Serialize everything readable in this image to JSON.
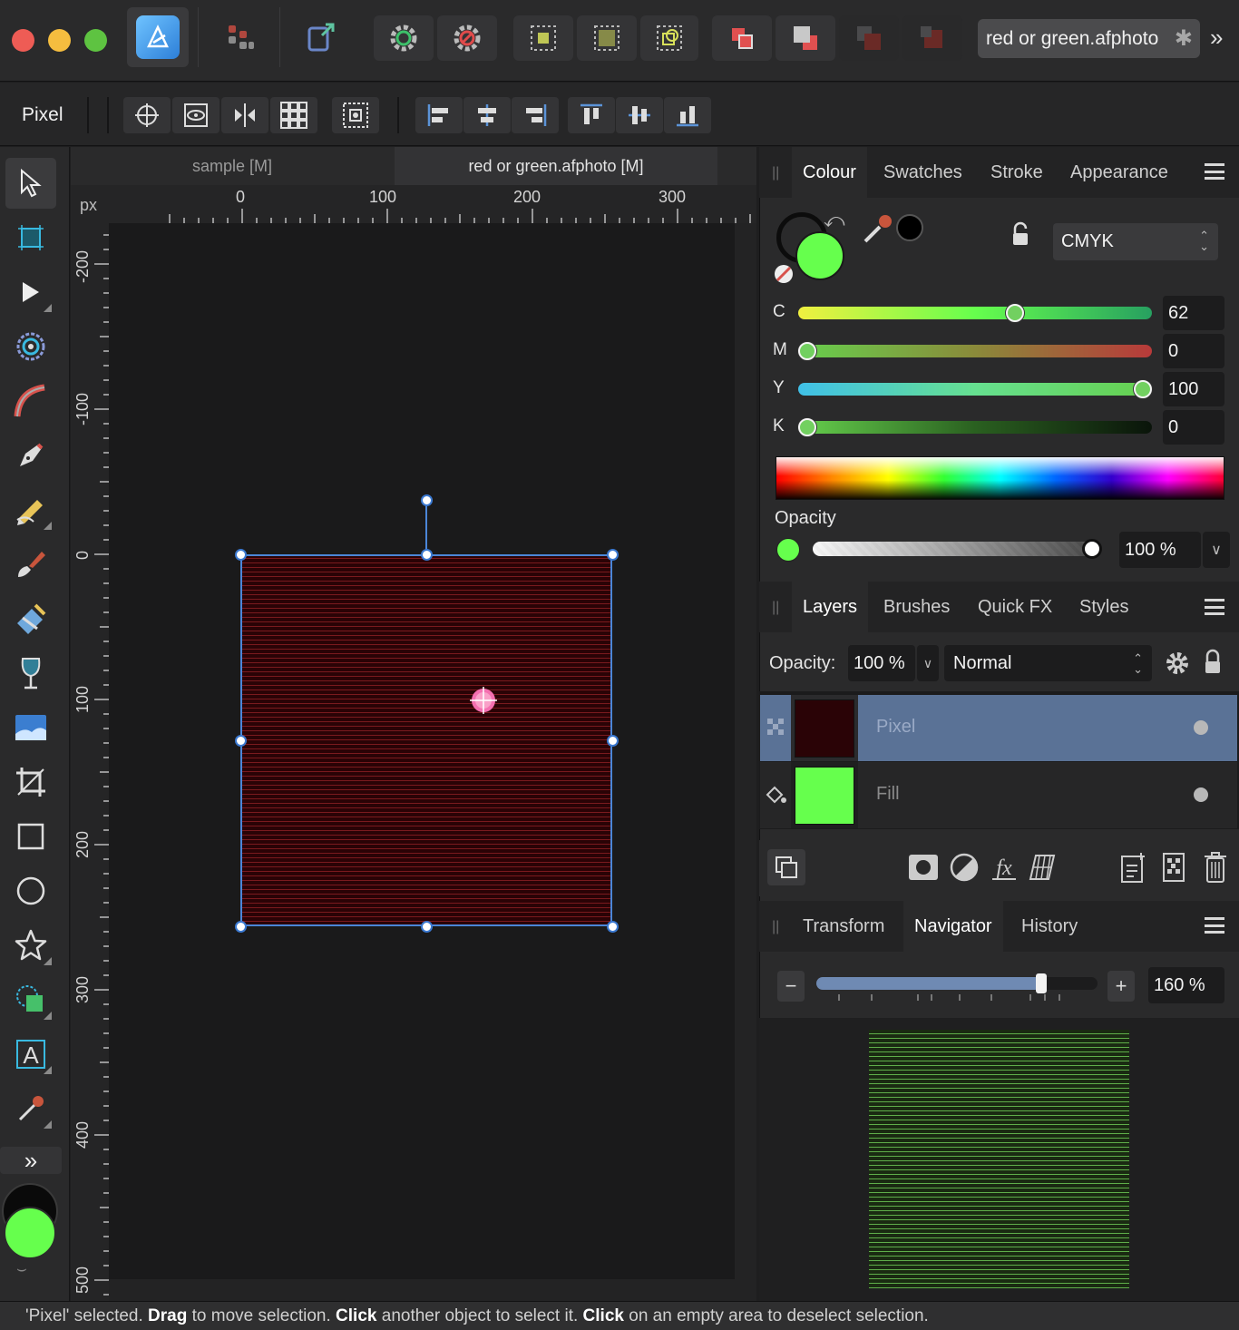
{
  "window": {
    "document_title": "red or green.afphoto"
  },
  "context_toolbar": {
    "label": "Pixel"
  },
  "document_tabs": [
    "sample [M]",
    "red or green.afphoto [M]"
  ],
  "rulers": {
    "unit": "px",
    "top_labels": [
      "0",
      "100",
      "200",
      "300"
    ],
    "left_labels": [
      "-200",
      "-100",
      "0",
      "100",
      "200",
      "300",
      "400",
      "500"
    ]
  },
  "colour_panel": {
    "tabs": [
      "Colour",
      "Swatches",
      "Stroke",
      "Appearance"
    ],
    "active_tab": "Colour",
    "model": "CMYK",
    "fill_color": "#66ff4d",
    "channels": [
      {
        "label": "C",
        "value": "62",
        "fraction": 0.62
      },
      {
        "label": "M",
        "value": "0",
        "fraction": 0.0
      },
      {
        "label": "Y",
        "value": "100",
        "fraction": 1.0
      },
      {
        "label": "K",
        "value": "0",
        "fraction": 0.0
      }
    ],
    "opacity_label": "Opacity",
    "opacity_value": "100 %"
  },
  "layers_panel": {
    "tabs": [
      "Layers",
      "Brushes",
      "Quick FX",
      "Styles"
    ],
    "active_tab": "Layers",
    "opacity_label": "Opacity:",
    "opacity_value": "100 %",
    "blend_mode": "Normal",
    "layers": [
      {
        "name": "Pixel",
        "selected": true,
        "thumb_color": "#2a0306"
      },
      {
        "name": "Fill",
        "selected": false,
        "thumb_color": "#66ff4d"
      }
    ]
  },
  "navigator_panel": {
    "tabs": [
      "Transform",
      "Navigator",
      "History"
    ],
    "active_tab": "Navigator",
    "zoom_value": "160 %",
    "zoom_fraction": 0.8
  },
  "status": {
    "parts": [
      {
        "text": "'Pixel' selected. ",
        "bold": false
      },
      {
        "text": "Drag",
        "bold": true
      },
      {
        "text": " to move selection. ",
        "bold": false
      },
      {
        "text": "Click",
        "bold": true
      },
      {
        "text": " another object to select it. ",
        "bold": false
      },
      {
        "text": "Click",
        "bold": true
      },
      {
        "text": " on an empty area to deselect selection.",
        "bold": false
      }
    ]
  },
  "colors": {
    "accent_blue": "#4b86d8",
    "fill_green": "#66ff4d",
    "pixel_red": "#2a0306"
  }
}
